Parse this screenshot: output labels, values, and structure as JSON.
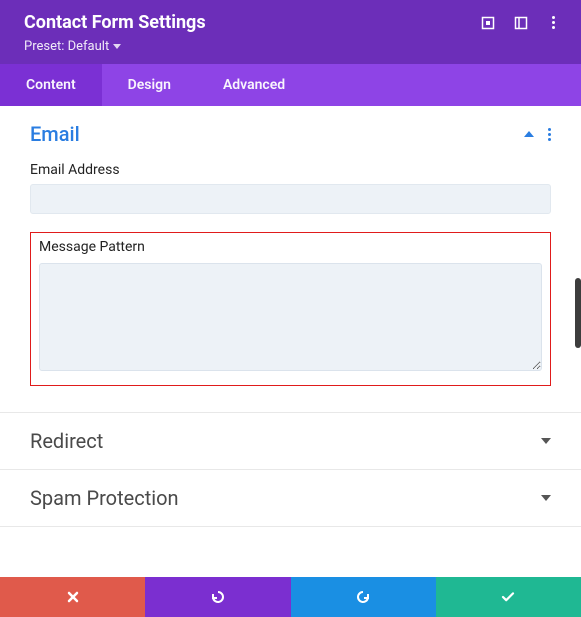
{
  "header": {
    "title": "Contact Form Settings",
    "preset_label": "Preset: Default"
  },
  "tabs": {
    "content": "Content",
    "design": "Design",
    "advanced": "Advanced",
    "active": "content"
  },
  "sections": {
    "email": {
      "title": "Email",
      "email_address_label": "Email Address",
      "email_address_value": "",
      "message_pattern_label": "Message Pattern",
      "message_pattern_value": ""
    },
    "redirect": {
      "title": "Redirect"
    },
    "spam": {
      "title": "Spam Protection"
    }
  },
  "icons": {
    "responsive": "responsive-icon",
    "sidebar": "sidebar-icon",
    "more_header": "more-icon",
    "close": "close-icon",
    "undo": "undo-icon",
    "redo": "redo-icon",
    "save": "check-icon"
  },
  "colors": {
    "header_bg": "#6c2eb9",
    "tabs_bg": "#8e44e6",
    "tab_active_bg": "#7a2fd4",
    "accent_link": "#2a7de1",
    "highlight_border": "#e01b1b",
    "footer_close": "#e05a4b",
    "footer_undo": "#7b2fd0",
    "footer_redo": "#1a8fe3",
    "footer_save": "#1fb893"
  }
}
